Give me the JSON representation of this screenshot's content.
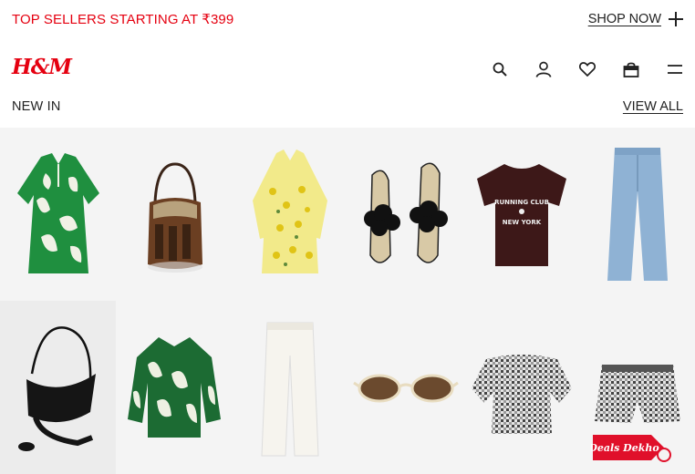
{
  "promo": {
    "text": "TOP SELLERS STARTING AT ₹399",
    "cta": "SHOP NOW"
  },
  "brand": {
    "logo": "H&M",
    "color": "#e50010"
  },
  "header_icons": [
    "search-icon",
    "account-icon",
    "favorites-icon",
    "bag-icon",
    "menu-icon"
  ],
  "section": {
    "title": "NEW IN",
    "view_all": "VIEW ALL"
  },
  "products": [
    {
      "name": "green-tropical-dress"
    },
    {
      "name": "brown-bucket-bag"
    },
    {
      "name": "yellow-floral-dress"
    },
    {
      "name": "black-flower-sandals"
    },
    {
      "name": "running-club-tshirt"
    },
    {
      "name": "light-blue-jeans"
    },
    {
      "name": "black-shoulder-bag"
    },
    {
      "name": "green-print-blouse"
    },
    {
      "name": "white-trousers"
    },
    {
      "name": "sunglasses"
    },
    {
      "name": "gingham-offshoulder-top"
    },
    {
      "name": "gingham-shorts"
    }
  ],
  "watermark": {
    "text": "Deals Dekho"
  }
}
